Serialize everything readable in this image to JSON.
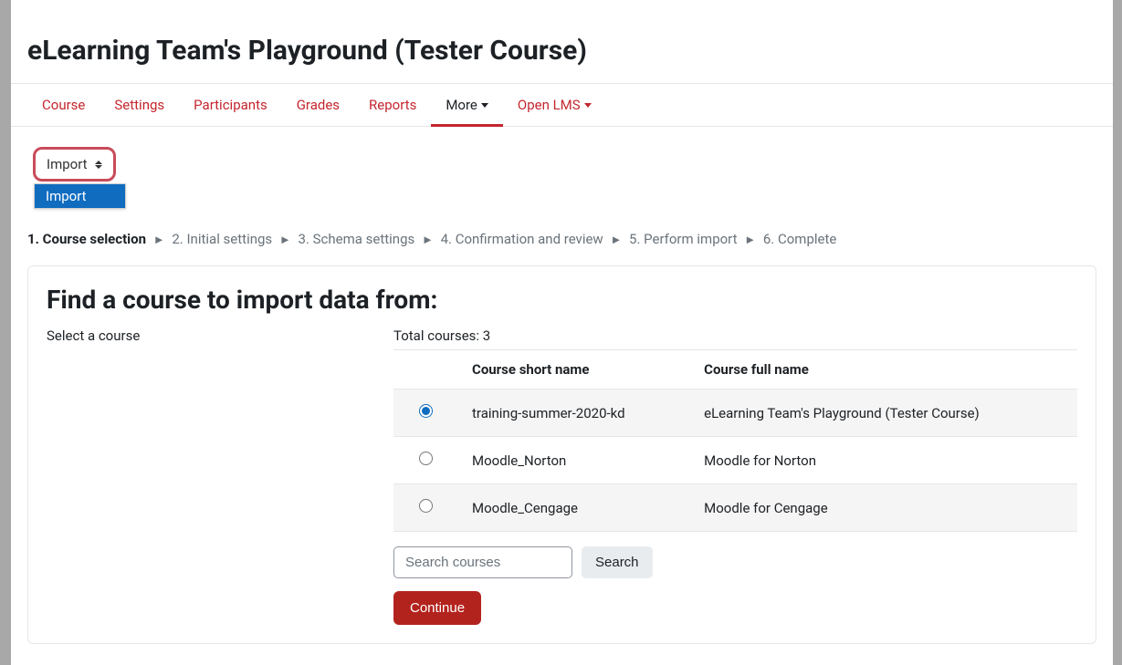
{
  "course_title": "eLearning Team's Playground (Tester Course)",
  "tabs": [
    {
      "label": "Course"
    },
    {
      "label": "Settings"
    },
    {
      "label": "Participants"
    },
    {
      "label": "Grades"
    },
    {
      "label": "Reports"
    },
    {
      "label": "More",
      "has_caret": true,
      "active": true
    },
    {
      "label": "Open LMS",
      "has_caret": true
    }
  ],
  "action_select": {
    "value": "Import",
    "option": "Import"
  },
  "steps": [
    {
      "label": "1. Course selection",
      "current": true
    },
    {
      "label": "2. Initial settings"
    },
    {
      "label": "3. Schema settings"
    },
    {
      "label": "4. Confirmation and review"
    },
    {
      "label": "5. Perform import"
    },
    {
      "label": "6. Complete"
    }
  ],
  "panel": {
    "heading": "Find a course to import data from:",
    "select_label": "Select a course",
    "total_label": "Total courses: 3",
    "columns": {
      "radio": "",
      "short": "Course short name",
      "full": "Course full name"
    },
    "rows": [
      {
        "selected": true,
        "short": "training-summer-2020-kd",
        "full": "eLearning Team's Playground (Tester Course)"
      },
      {
        "selected": false,
        "short": "Moodle_Norton",
        "full": "Moodle for Norton"
      },
      {
        "selected": false,
        "short": "Moodle_Cengage",
        "full": "Moodle for Cengage"
      }
    ],
    "search_placeholder": "Search courses",
    "search_btn": "Search",
    "continue_btn": "Continue"
  }
}
